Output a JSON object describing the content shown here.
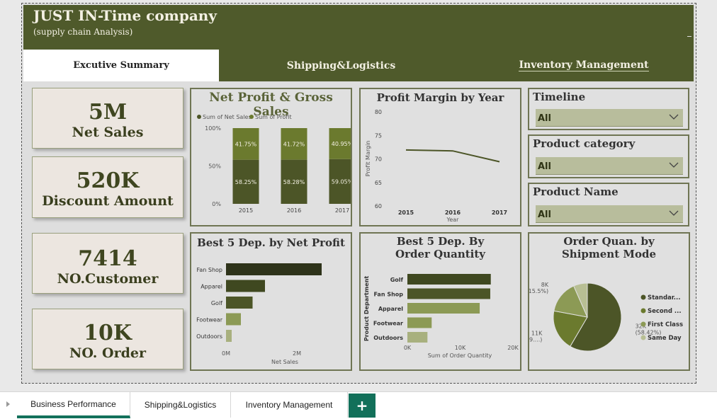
{
  "header": {
    "title": "JUST IN-Time company",
    "subtitle": "(supply chain Analysis)"
  },
  "page_tabs": [
    {
      "label": "Excutive Summary",
      "active": true
    },
    {
      "label": "Shipping&Logistics",
      "active": false
    },
    {
      "label": "Inventory Management",
      "active": false
    }
  ],
  "kpis": [
    {
      "value": "5M",
      "label": "Net Sales"
    },
    {
      "value": "520K",
      "label": "Discount Amount"
    },
    {
      "value": "7414",
      "label": "NO.Customer"
    },
    {
      "value": "10K",
      "label": "NO. Order"
    }
  ],
  "slicers": [
    {
      "title": "Timeline",
      "value": "All"
    },
    {
      "title": "Product category",
      "value": "All"
    },
    {
      "title": "Product Name",
      "value": "All"
    }
  ],
  "colors": {
    "header": "#4f5a2b",
    "dark": "#4c5527",
    "olive": "#6b7a2e",
    "mid": "#8c9a55",
    "light": "#b8bf94",
    "accent": "#12705a"
  },
  "chart_data": [
    {
      "type": "bar",
      "stacked": true,
      "title": "Net Profit & Gross Sales",
      "categories": [
        "2015",
        "2016",
        "2017"
      ],
      "series": [
        {
          "name": "Sum of Net Sales",
          "values": [
            58.25,
            58.28,
            59.05
          ],
          "labels": [
            "58.25%",
            "58.28%",
            "59.05%"
          ],
          "color": "#4c5527"
        },
        {
          "name": "Sum of Profit",
          "values": [
            41.75,
            41.72,
            40.95
          ],
          "labels": [
            "41.75%",
            "41.72%",
            "40.95%"
          ],
          "color": "#6b7a2e"
        }
      ],
      "yticks": [
        "0%",
        "50%",
        "100%"
      ],
      "ylim": [
        0,
        100
      ],
      "legend": "top-left"
    },
    {
      "type": "line",
      "title": "Profit Margin by Year",
      "x": [
        "2015",
        "2016",
        "2017"
      ],
      "values": [
        71.9,
        71.7,
        69.4
      ],
      "xlabel": "Year",
      "ylabel": "Profit Margin",
      "yticks": [
        "60",
        "65",
        "70",
        "75",
        "80"
      ],
      "ylim": [
        60,
        80
      ]
    },
    {
      "type": "bar",
      "orientation": "horizontal",
      "title": "Best 5 Dep. by Net Profit",
      "categories": [
        "Fan Shop",
        "Apparel",
        "Golf",
        "Footwear",
        "Outdoors"
      ],
      "values": [
        2700000,
        1100000,
        750000,
        420000,
        160000
      ],
      "colors": [
        "#2e331a",
        "#3f4820",
        "#4c5527",
        "#8c9a55",
        "#a8b07e"
      ],
      "xlabel": "Net Sales",
      "xticks": [
        "0M",
        "2M"
      ],
      "xlim": [
        0,
        3300000
      ]
    },
    {
      "type": "bar",
      "orientation": "horizontal",
      "title": "Best 5 Dep. By Order Quantity",
      "categories": [
        "Golf",
        "Fan Shop",
        "Apparel",
        "Footwear",
        "Outdoors"
      ],
      "values": [
        15800,
        15700,
        13700,
        4600,
        3800
      ],
      "colors": [
        "#3f4820",
        "#4c5527",
        "#8c9a55",
        "#8c9a55",
        "#a8b07e"
      ],
      "xlabel": "Sum of Order Quantity",
      "ylabel": "Product Department",
      "xticks": [
        "0K",
        "10K",
        "20K"
      ],
      "xlim": [
        0,
        20000
      ]
    },
    {
      "type": "pie",
      "title": "Order Quan. by Shipment Mode",
      "slices": [
        {
          "name": "Standar...",
          "value": 58.42,
          "label": "32K\n(58.42%)",
          "color": "#4c5527"
        },
        {
          "name": "Second ...",
          "value": 19.5,
          "label": "11K\n(19....)",
          "color": "#6b7a2e"
        },
        {
          "name": "First Class",
          "value": 15.5,
          "label": "8K\n(15.5%)",
          "color": "#8c9a55"
        },
        {
          "name": "Same Day",
          "value": 6.58,
          "label": "",
          "color": "#b8bf94"
        }
      ],
      "legend": "right"
    }
  ],
  "bottom_tabs": [
    {
      "label": "Business Performance",
      "active": true
    },
    {
      "label": "Shipping&Logistics",
      "active": false
    },
    {
      "label": "Inventory Management",
      "active": false
    }
  ],
  "add_tab": {
    "label": "+"
  }
}
